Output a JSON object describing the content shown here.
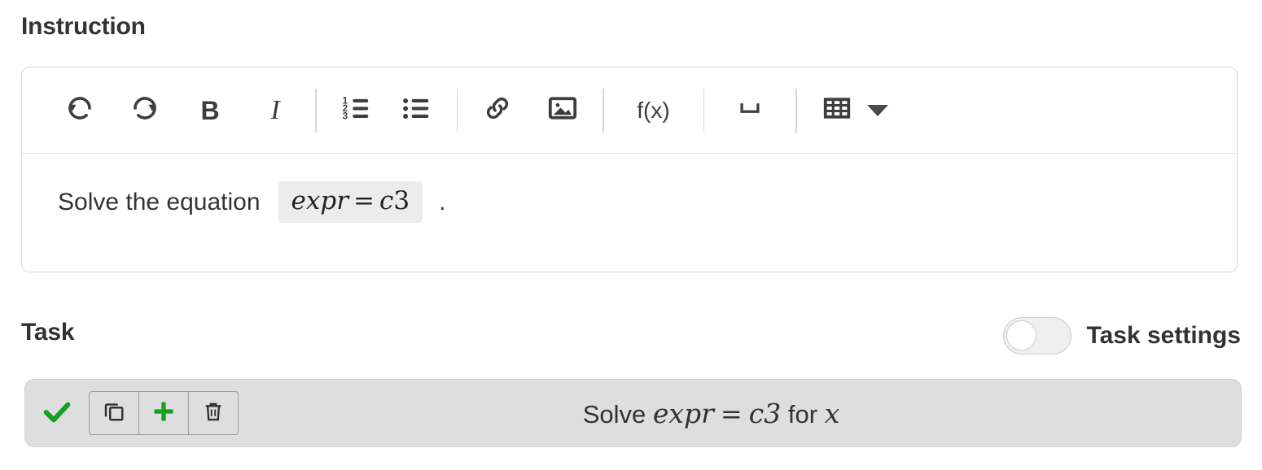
{
  "instruction": {
    "heading": "Instruction",
    "toolbar": {
      "undo": "undo-icon",
      "redo": "redo-icon",
      "bold": "B",
      "italic": "I",
      "ordered_list": "ordered-list-icon",
      "bullet_list": "bullet-list-icon",
      "link": "link-icon",
      "image": "image-icon",
      "formula": "f(x)",
      "space": "space-icon",
      "table": "table-icon",
      "table_dropdown": "chevron-down-icon"
    },
    "body": {
      "prefix": "Solve the equation",
      "equation_lhs": "expr",
      "equation_op": "=",
      "equation_rhs_var": "c",
      "equation_rhs_num": "3",
      "suffix": "."
    }
  },
  "task": {
    "heading": "Task",
    "settings_label": "Task settings",
    "settings_toggle_state": "off",
    "row": {
      "check_icon": "check-icon",
      "duplicate_icon": "copy-icon",
      "add_icon": "plus-icon",
      "delete_icon": "trash-icon",
      "text_prefix": "Solve",
      "equation_lhs": "expr",
      "equation_op": "=",
      "equation_rhs_var": "c",
      "equation_rhs_num": "3",
      "text_middle": "for",
      "variable": "x"
    }
  },
  "colors": {
    "accent_green": "#15a01f",
    "text": "#333333",
    "row_bg": "#dedede",
    "chip_bg": "#ececec",
    "border": "#d6d6d6"
  }
}
